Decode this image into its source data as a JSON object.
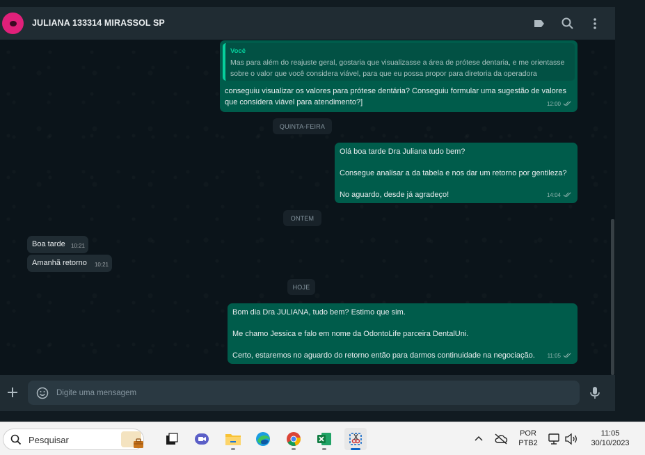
{
  "header": {
    "title": "JULIANA 133314 MIRASSOL SP",
    "icons": [
      "label-icon",
      "search-icon",
      "menu-icon"
    ]
  },
  "messages": {
    "m1": {
      "quote_author": "Você",
      "quote_line1": "Mas para além do reajuste geral, gostaria que visualizasse a área de prótese dentaria, e me orientasse",
      "quote_line2": "sobre o valor que você considera viável, para que eu possa propor para diretoria da operadora",
      "line1": "conseguiu visualizar os valores para prótese dentária? Conseguiu formular uma sugestão de valores",
      "line2": "que considera viável para atendimento?]",
      "time": "12:00"
    },
    "day1": "QUINTA-FEIRA",
    "m2": {
      "line1": "Olá boa tarde Dra Juliana tudo bem?",
      "line2": "Consegue analisar a da tabela e nos dar um retorno por gentileza?",
      "line3": "No aguardo, desde já agradeço!",
      "time": "14:04"
    },
    "day2": "ONTEM",
    "m3": {
      "text": "Boa tarde",
      "time": "10:21"
    },
    "m4": {
      "text": "Amanhã retorno",
      "time": "10:21"
    },
    "day3": "HOJE",
    "m5": {
      "line1": "Bom dia Dra JULIANA, tudo bem? Estimo que sim.",
      "line2": "Me chamo Jessica e falo em nome da OdontoLife parceira DentalUni.",
      "line3": "Certo, estaremos no aguardo do retorno então para darmos continuidade na negociação.",
      "time": "11:05"
    }
  },
  "composer": {
    "placeholder": "Digite uma mensagem",
    "icons": [
      "plus-icon",
      "emoji-icon",
      "mic-icon"
    ]
  },
  "taskbar": {
    "search_label": "Pesquisar",
    "apps": [
      "widgets",
      "task-view",
      "teams-chat",
      "file-explorer",
      "edge",
      "chrome",
      "excel",
      "snipping-tool"
    ],
    "language_line1": "POR",
    "language_line2": "PTB2",
    "clock_time": "11:05",
    "clock_date": "30/10/2023"
  },
  "colors": {
    "outgoing_bubble": "#005c4b",
    "incoming_bubble": "#202c33",
    "chat_background": "#0b141a",
    "header_background": "#202c33",
    "accent": "#06cf9c",
    "read_ticks": "#53bdeb"
  }
}
